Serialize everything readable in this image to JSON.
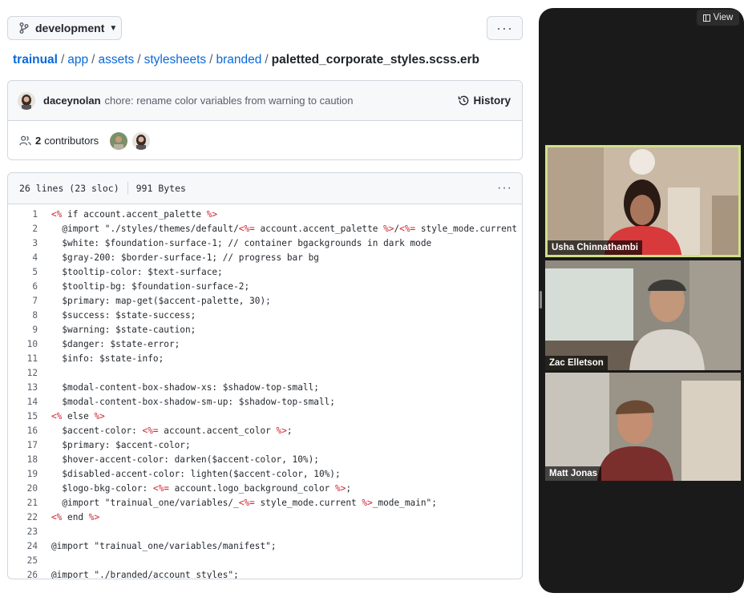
{
  "branch": {
    "name": "development",
    "more": "···"
  },
  "breadcrumb": {
    "root": "trainual",
    "parts": [
      "app",
      "assets",
      "stylesheets",
      "branded"
    ],
    "separator": "/",
    "file": "paletted_corporate_styles.scss.erb"
  },
  "commit": {
    "author": "daceynolan",
    "message": "chore: rename color variables from warning to caution",
    "history_label": "History"
  },
  "contributors": {
    "count": "2",
    "label": "contributors"
  },
  "file_info": {
    "lines": "26 lines (23 sloc)",
    "size": "991 Bytes",
    "more": "···"
  },
  "code": [
    {
      "n": "1",
      "t": "<% if account.accent_palette %>"
    },
    {
      "n": "2",
      "t": "  @import \"./styles/themes/default/<%= account.accent_palette %>/<%= style_mode.current %>_"
    },
    {
      "n": "3",
      "t": "  $white: $foundation-surface-1; // container bgackgrounds in dark mode"
    },
    {
      "n": "4",
      "t": "  $gray-200: $border-surface-1; // progress bar bg"
    },
    {
      "n": "5",
      "t": "  $tooltip-color: $text-surface;"
    },
    {
      "n": "6",
      "t": "  $tooltip-bg: $foundation-surface-2;"
    },
    {
      "n": "7",
      "t": "  $primary: map-get($accent-palette, 30);"
    },
    {
      "n": "8",
      "t": "  $success: $state-success;"
    },
    {
      "n": "9",
      "t": "  $warning: $state-caution;"
    },
    {
      "n": "10",
      "t": "  $danger: $state-error;"
    },
    {
      "n": "11",
      "t": "  $info: $state-info;"
    },
    {
      "n": "12",
      "t": ""
    },
    {
      "n": "13",
      "t": "  $modal-content-box-shadow-xs: $shadow-top-small;"
    },
    {
      "n": "14",
      "t": "  $modal-content-box-shadow-sm-up: $shadow-top-small;"
    },
    {
      "n": "15",
      "t": "<% else %>"
    },
    {
      "n": "16",
      "t": "  $accent-color: <%= account.accent_color %>;"
    },
    {
      "n": "17",
      "t": "  $primary: $accent-color;"
    },
    {
      "n": "18",
      "t": "  $hover-accent-color: darken($accent-color, 10%);"
    },
    {
      "n": "19",
      "t": "  $disabled-accent-color: lighten($accent-color, 10%);"
    },
    {
      "n": "20",
      "t": "  $logo-bkg-color: <%= account.logo_background_color %>;"
    },
    {
      "n": "21",
      "t": "  @import \"trainual_one/variables/_<%= style_mode.current %>_mode_main\";"
    },
    {
      "n": "22",
      "t": "<% end %>"
    },
    {
      "n": "23",
      "t": ""
    },
    {
      "n": "24",
      "t": "@import \"trainual_one/variables/manifest\";"
    },
    {
      "n": "25",
      "t": ""
    },
    {
      "n": "26",
      "t": "@import \"./branded/account_styles\";"
    }
  ],
  "video": {
    "view_label": "View",
    "participants": [
      {
        "name": "Usha Chinnathambi",
        "active": true
      },
      {
        "name": "Zac Elletson",
        "active": false
      },
      {
        "name": "Matt Jonas",
        "active": false
      }
    ]
  },
  "colors": {
    "link": "#0969da",
    "erb": "#cf222e",
    "active_speaker": "#cfe08a"
  }
}
